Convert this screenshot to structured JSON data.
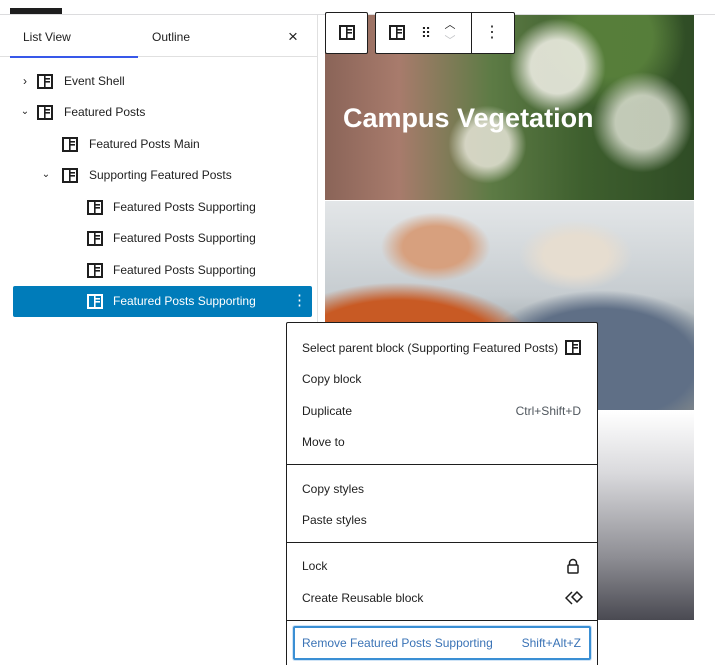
{
  "tabs": {
    "list_view": "List View",
    "outline": "Outline"
  },
  "panel": {
    "close_glyph": "×"
  },
  "tree": {
    "items": [
      {
        "label": "Event Shell",
        "level": 0,
        "expander": "collapsed"
      },
      {
        "label": "Featured Posts",
        "level": 0,
        "expander": "expanded"
      },
      {
        "label": "Featured Posts Main",
        "level": 1,
        "expander": "none"
      },
      {
        "label": "Supporting Featured Posts",
        "level": 1,
        "expander": "expanded"
      },
      {
        "label": "Featured Posts Supporting",
        "level": 2,
        "expander": "none"
      },
      {
        "label": "Featured Posts Supporting",
        "level": 2,
        "expander": "none"
      },
      {
        "label": "Featured Posts Supporting",
        "level": 2,
        "expander": "none"
      },
      {
        "label": "Featured Posts Supporting",
        "level": 2,
        "expander": "none",
        "selected": true
      }
    ]
  },
  "canvas": {
    "hero_title": "Campus Vegetation"
  },
  "toolbar": {
    "icons": [
      "block-icon",
      "parent-block-icon",
      "drag-handle-icon",
      "move-up-icon",
      "move-down-icon",
      "more-options-icon"
    ]
  },
  "menu": {
    "items": [
      {
        "label": "Select parent block (Supporting Featured Posts)",
        "shortcut": "",
        "icon": "block-icon"
      },
      {
        "label": "Copy block",
        "shortcut": "",
        "icon": ""
      },
      {
        "label": "Duplicate",
        "shortcut": "Ctrl+Shift+D",
        "icon": ""
      },
      {
        "label": "Move to",
        "shortcut": "",
        "icon": ""
      },
      {
        "label": "Copy styles",
        "shortcut": "",
        "icon": ""
      },
      {
        "label": "Paste styles",
        "shortcut": "",
        "icon": ""
      },
      {
        "label": "Lock",
        "shortcut": "",
        "icon": "lock-icon"
      },
      {
        "label": "Create Reusable block",
        "shortcut": "",
        "icon": "reusable-block-icon"
      },
      {
        "label": "Remove Featured Posts Supporting",
        "shortcut": "Shift+Alt+Z",
        "icon": ""
      }
    ]
  },
  "colors": {
    "selected_row": "#007cba",
    "tab_indicator": "#3858e9",
    "focus_outline": "#3a8fd4"
  }
}
